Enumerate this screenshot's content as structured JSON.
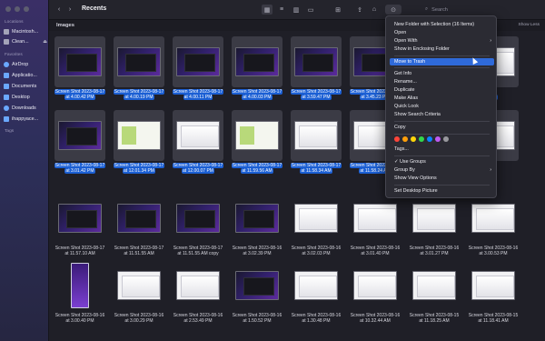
{
  "window": {
    "title": "Recents"
  },
  "toolbar": {
    "back_icon": "chevron-left-icon",
    "forward_icon": "chevron-right-icon",
    "search_placeholder": "Search"
  },
  "sidebar": {
    "locations_header": "Locations",
    "favorites_header": "Favorites",
    "tags_header": "Tags",
    "locations": [
      {
        "label": "Macintosh..."
      },
      {
        "label": "Clean...",
        "eject": "⏏"
      }
    ],
    "favorites": [
      {
        "label": "AirDrop"
      },
      {
        "label": "Applicatio..."
      },
      {
        "label": "Documents"
      },
      {
        "label": "Desktop"
      },
      {
        "label": "Downloads"
      },
      {
        "label": "ihappyace..."
      }
    ]
  },
  "group": {
    "title": "Images",
    "show_less": "Show Less"
  },
  "files": [
    {
      "line1": "Screen Shot 2023-08-17",
      "line2": "at 4.00.42 PM",
      "kind": "dark",
      "selected": true
    },
    {
      "line1": "Screen Shot 2023-08-17",
      "line2": "at 4.00.19 PM",
      "kind": "dark",
      "selected": true
    },
    {
      "line1": "Screen Shot 2023-08-17",
      "line2": "at 4.00.11 PM",
      "kind": "dark",
      "selected": true
    },
    {
      "line1": "Screen Shot 2023-08-17",
      "line2": "at 4.00.03 PM",
      "kind": "dark",
      "selected": true
    },
    {
      "line1": "Screen Shot 2023-08-17",
      "line2": "at 3.59.47 PM",
      "kind": "dark",
      "selected": true
    },
    {
      "line1": "Screen Shot 2023-08-17",
      "line2": "at 3.45.23 PM",
      "kind": "dark",
      "selected": true
    },
    {
      "line1": "",
      "line2": "",
      "kind": "dark",
      "selected": true
    },
    {
      "line1": "",
      "line2": ".jpg",
      "kind": "light",
      "selected": true
    },
    {
      "line1": "Screen Shot 2023-08-17",
      "line2": "at 3.01.42 PM",
      "kind": "dark",
      "selected": true
    },
    {
      "line1": "Screen Shot 2023-08-17",
      "line2": "at 12.01.34 PM",
      "kind": "green",
      "selected": true
    },
    {
      "line1": "Screen Shot 2023-08-17",
      "line2": "at 12.00.07 PM",
      "kind": "light",
      "selected": true
    },
    {
      "line1": "Screen Shot 2023-08-17",
      "line2": "at 11.59.56 AM",
      "kind": "green",
      "selected": true
    },
    {
      "line1": "Screen Shot 2023-08-17",
      "line2": "at 11.58.34 AM",
      "kind": "light",
      "selected": true
    },
    {
      "line1": "Screen Shot 2023-08-17",
      "line2": "at 11.58.24 AM",
      "kind": "light",
      "selected": true
    },
    {
      "line1": "",
      "line2": "",
      "kind": "light",
      "selected": true
    },
    {
      "line1": "",
      "line2": "",
      "kind": "light",
      "selected": true
    },
    {
      "line1": "Screen Shot 2023-08-17",
      "line2": "at 11.57.10 AM",
      "kind": "dark",
      "selected": false
    },
    {
      "line1": "Screen Shot 2023-08-17",
      "line2": "at 11.51.55 AM",
      "kind": "dark",
      "selected": false
    },
    {
      "line1": "Screen Shot 2023-08-17",
      "line2": "at 11.51.55 AM copy",
      "kind": "dark",
      "selected": false
    },
    {
      "line1": "Screen Shot 2023-08-16",
      "line2": "at 3.02.39 PM",
      "kind": "dark",
      "selected": false
    },
    {
      "line1": "Screen Shot 2023-08-16",
      "line2": "at 3.02.03 PM",
      "kind": "light",
      "selected": false
    },
    {
      "line1": "Screen Shot 2023-08-16",
      "line2": "at 3.01.40 PM",
      "kind": "light",
      "selected": false
    },
    {
      "line1": "Screen Shot 2023-08-16",
      "line2": "at 3.01.27 PM",
      "kind": "light",
      "selected": false
    },
    {
      "line1": "Screen Shot 2023-08-16",
      "line2": "at 3.00.53 PM",
      "kind": "light",
      "selected": false
    },
    {
      "line1": "Screen Shot 2023-08-16",
      "line2": "at 3.00.40 PM",
      "kind": "tall",
      "selected": false
    },
    {
      "line1": "Screen Shot 2023-08-16",
      "line2": "at 3.00.29 PM",
      "kind": "light",
      "selected": false
    },
    {
      "line1": "Screen Shot 2023-08-16",
      "line2": "at 2.53.49 PM",
      "kind": "light",
      "selected": false
    },
    {
      "line1": "Screen Shot 2023-08-16",
      "line2": "at 1.50.52 PM",
      "kind": "dark",
      "selected": false
    },
    {
      "line1": "Screen Shot 2023-08-16",
      "line2": "at 1.30.48 PM",
      "kind": "light",
      "selected": false
    },
    {
      "line1": "Screen Shot 2023-08-16",
      "line2": "at 10.32.44 AM",
      "kind": "light",
      "selected": false
    },
    {
      "line1": "Screen Shot 2023-08-15",
      "line2": "at 11.18.25 AM",
      "kind": "light",
      "selected": false
    },
    {
      "line1": "Screen Shot 2023-08-15",
      "line2": "at 11.18.41 AM",
      "kind": "light",
      "selected": false
    }
  ],
  "context_menu": {
    "new_folder": "New Folder with Selection (16 Items)",
    "open": "Open",
    "open_with": "Open With",
    "show_enclosing": "Show in Enclosing Folder",
    "move_to_trash": "Move to Trash",
    "get_info": "Get Info",
    "rename": "Rename...",
    "duplicate": "Duplicate",
    "make_alias": "Make Alias",
    "quick_look": "Quick Look",
    "show_search_criteria": "Show Search Criteria",
    "copy": "Copy",
    "tags": "Tags...",
    "use_groups": "✓ Use Groups",
    "group_by": "Group By",
    "show_view_options": "Show View Options",
    "set_desktop_picture": "Set Desktop Picture",
    "tag_colors": [
      "#ff453a",
      "#ff9f0a",
      "#ffd60a",
      "#32d74b",
      "#0a84ff",
      "#bf5af2",
      "#98989d"
    ]
  },
  "accent_color": "#1b5fd4"
}
